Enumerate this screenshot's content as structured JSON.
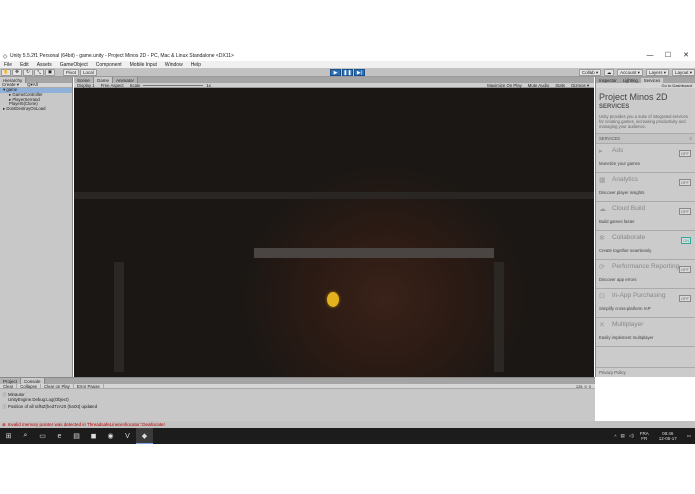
{
  "window": {
    "title": "Unity 5.5.2f1 Personal (64bit) - game.unity - Project Minos 2D - PC, Mac & Linux Standalone <DX11>",
    "controls": [
      "—",
      "☐",
      "✕"
    ]
  },
  "menu": [
    "File",
    "Edit",
    "Assets",
    "GameObject",
    "Component",
    "Mobile Input",
    "Window",
    "Help"
  ],
  "toolbar": {
    "pivot": "Pivot",
    "local": "Local",
    "collab": "Collab ▾",
    "account": "Account ▾",
    "layers": "Layers ▾",
    "layout": "Layout ▾"
  },
  "hierarchy": {
    "tab": "Hierarchy",
    "create": "Create ▾",
    "search": "Q▾All",
    "items": [
      {
        "label": "▾ game",
        "selected": true,
        "indent": false
      },
      {
        "label": "▸ GameController",
        "selected": false,
        "indent": true
      },
      {
        "label": "▸ PlayerSerrand",
        "selected": false,
        "indent": true
      },
      {
        "label": "Player5(Clone)",
        "selected": false,
        "indent": true
      },
      {
        "label": "▸ DontDestroyOnLoad",
        "selected": false,
        "indent": false
      }
    ]
  },
  "game_tabs": {
    "scene": "Scene",
    "game": "Game",
    "animator": "Animator"
  },
  "gamebar": {
    "display": "Display 1",
    "aspect": "Free Aspect",
    "scale_label": "Scale",
    "scale_value": "1x",
    "maximize": "Maximize On Play",
    "mute": "Mute Audio",
    "stats": "Stats",
    "gizmos": "Gizmos ▾"
  },
  "services": {
    "tabs": [
      "Inspector",
      "Lighting",
      "Services"
    ],
    "go_to_dashboard": "Go to Dashboard",
    "project_title": "Project Minos 2D",
    "heading": "SERVICES",
    "description": "Unity provides you a suite of integrated services for creating games, increasing productivity and managing your audience.",
    "section_label": "SERVICES",
    "items": [
      {
        "name": "Ads",
        "icon": "▸",
        "desc": "Monetize your games",
        "toggle": "OFF",
        "on": false
      },
      {
        "name": "Analytics",
        "icon": "▦",
        "desc": "Discover player insights",
        "toggle": "OFF",
        "on": false
      },
      {
        "name": "Cloud Build",
        "icon": "☁",
        "desc": "Build games faster",
        "toggle": "OFF",
        "on": false
      },
      {
        "name": "Collaborate",
        "icon": "✻",
        "desc": "Create together seamlessly",
        "toggle": "ON",
        "on": true
      },
      {
        "name": "Performance Reporting",
        "icon": "⟳",
        "desc": "Discover app errors",
        "toggle": "OFF",
        "on": false
      },
      {
        "name": "In-App Purchasing",
        "icon": "⊡",
        "desc": "Simplify cross-platform IAP",
        "toggle": "OFF",
        "on": false
      },
      {
        "name": "Multiplayer",
        "icon": "✕",
        "desc": "Easily implement multiplayer",
        "toggle": "",
        "on": false
      }
    ],
    "privacy": "Privacy Policy"
  },
  "console": {
    "tabs": [
      "Project",
      "Console"
    ],
    "buttons": [
      "Clear",
      "Collapse",
      "Clear on Play",
      "Error Pause"
    ],
    "lines": [
      "Minautor",
      "UnityEngine.Debug:Log(Object)",
      "Position of all rafNZ(hedTzAz0 (hatXt) updated"
    ],
    "counts": [
      "125",
      "0",
      "0"
    ]
  },
  "status_error": "Invalid memory pointer was detected in ThreadsafeLinearAllocator::Deallocate!",
  "taskbar": {
    "icons": [
      "⊞",
      "⌕",
      "▭",
      "e",
      "▤",
      "◼",
      "◉",
      "V",
      "◆"
    ],
    "lang_top": "FRA",
    "lang_bottom": "FR",
    "time": "08:46",
    "date": "12-05-17"
  }
}
